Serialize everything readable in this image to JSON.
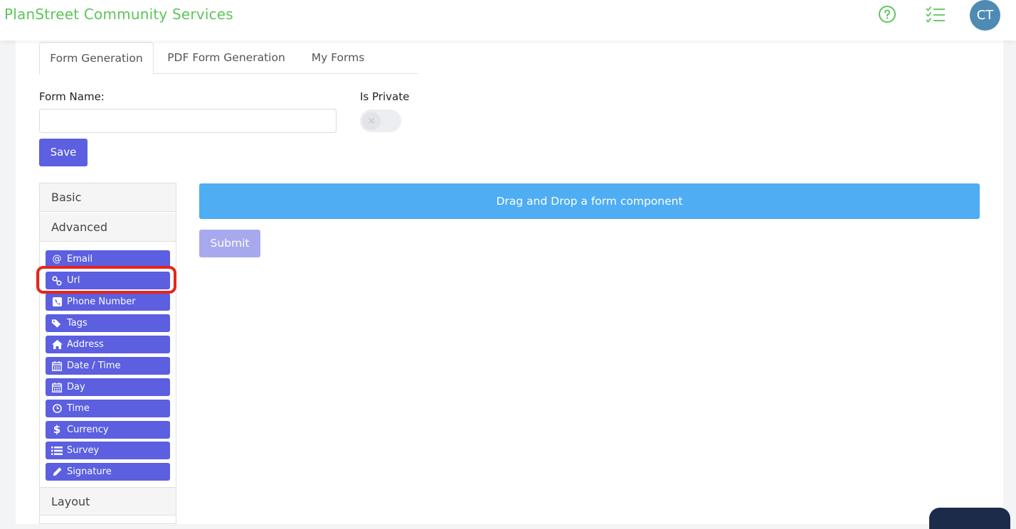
{
  "header": {
    "title": "PlanStreet Community Services",
    "avatar_initials": "CT",
    "help_icon": "help-circle-icon",
    "tasks_icon": "checklist-icon"
  },
  "tabs": [
    {
      "label": "Form Generation",
      "active": true
    },
    {
      "label": "PDF Form Generation",
      "active": false
    },
    {
      "label": "My Forms",
      "active": false
    }
  ],
  "form": {
    "name_label": "Form Name:",
    "name_value": "",
    "private_label": "Is Private",
    "private_on": false,
    "save_label": "Save"
  },
  "sidebar": {
    "basic_label": "Basic",
    "advanced_label": "Advanced",
    "layout_label": "Layout",
    "components": [
      {
        "label": "Email",
        "icon": "at-icon"
      },
      {
        "label": "Url",
        "icon": "link-icon"
      },
      {
        "label": "Phone Number",
        "icon": "phone-icon"
      },
      {
        "label": "Tags",
        "icon": "tags-icon"
      },
      {
        "label": "Address",
        "icon": "home-icon"
      },
      {
        "label": "Date / Time",
        "icon": "calendar-icon"
      },
      {
        "label": "Day",
        "icon": "calendar-icon"
      },
      {
        "label": "Time",
        "icon": "clock-icon"
      },
      {
        "label": "Currency",
        "icon": "dollar-icon"
      },
      {
        "label": "Survey",
        "icon": "list-icon"
      },
      {
        "label": "Signature",
        "icon": "pencil-icon"
      }
    ]
  },
  "builder": {
    "dropzone_text": "Drag and Drop a form component",
    "submit_label": "Submit"
  },
  "colors": {
    "brand_green": "#5ec45a",
    "primary": "#5b5fe0",
    "dropzone": "#4eadf3",
    "highlight": "#e8251b"
  }
}
